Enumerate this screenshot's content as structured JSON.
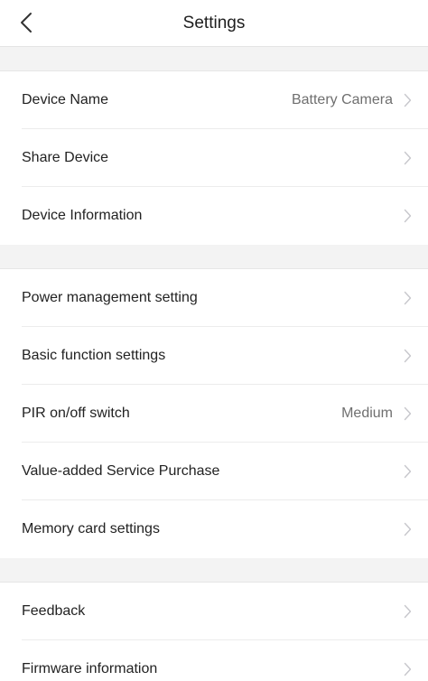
{
  "header": {
    "title": "Settings",
    "back_icon": "chevron-left-icon"
  },
  "groups": [
    {
      "items": [
        {
          "label": "Device Name",
          "value": "Battery Camera"
        },
        {
          "label": "Share Device",
          "value": ""
        },
        {
          "label": "Device Information",
          "value": ""
        }
      ]
    },
    {
      "items": [
        {
          "label": "Power management setting",
          "value": ""
        },
        {
          "label": "Basic function settings",
          "value": ""
        },
        {
          "label": "PIR on/off switch",
          "value": "Medium"
        },
        {
          "label": "Value-added Service Purchase",
          "value": ""
        },
        {
          "label": "Memory card settings",
          "value": ""
        }
      ]
    },
    {
      "items": [
        {
          "label": "Feedback",
          "value": ""
        },
        {
          "label": "Firmware information",
          "value": ""
        }
      ]
    }
  ],
  "colors": {
    "background": "#ffffff",
    "separator_band": "#f3f3f3",
    "divider": "#ececec",
    "text_primary": "#222222",
    "text_secondary": "#6f6f6f",
    "chevron": "#c7c7cc"
  }
}
